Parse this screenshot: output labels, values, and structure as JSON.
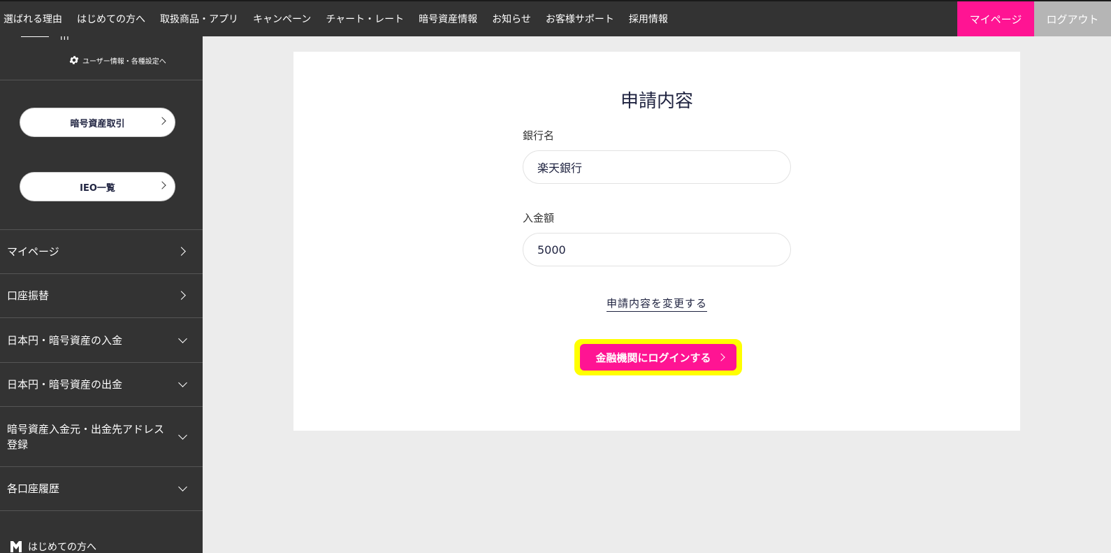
{
  "topnav": {
    "items": [
      "選ばれる理由",
      "はじめての方へ",
      "取扱商品・アプリ",
      "キャンペーン",
      "チャート・レート",
      "暗号資産情報",
      "お知らせ",
      "お客様サポート",
      "採用情報"
    ],
    "mypage": "マイページ",
    "logout": "ログアウト"
  },
  "sidebar": {
    "user_suffix": "m",
    "settings_label": "ユーザー情報・各種設定へ",
    "pills": [
      "暗号資産取引",
      "IEO一覧"
    ],
    "menu": [
      "マイページ",
      "口座振替",
      "日本円・暗号資産の入金",
      "日本円・暗号資産の出金",
      "暗号資産入金元・出金先アドレス登録",
      "各口座履歴"
    ],
    "bottom_link": "はじめての方へ"
  },
  "main": {
    "title": "申請内容",
    "bank_label": "銀行名",
    "bank_value": "楽天銀行",
    "amount_label": "入金額",
    "amount_value": "5000",
    "change_link": "申請内容を変更する",
    "login_button": "金融機関にログインする"
  },
  "colors": {
    "accent": "#ff1493",
    "highlight": "#ffff00",
    "nav_bg": "#333333",
    "logout_bg": "#b5b5b5"
  }
}
